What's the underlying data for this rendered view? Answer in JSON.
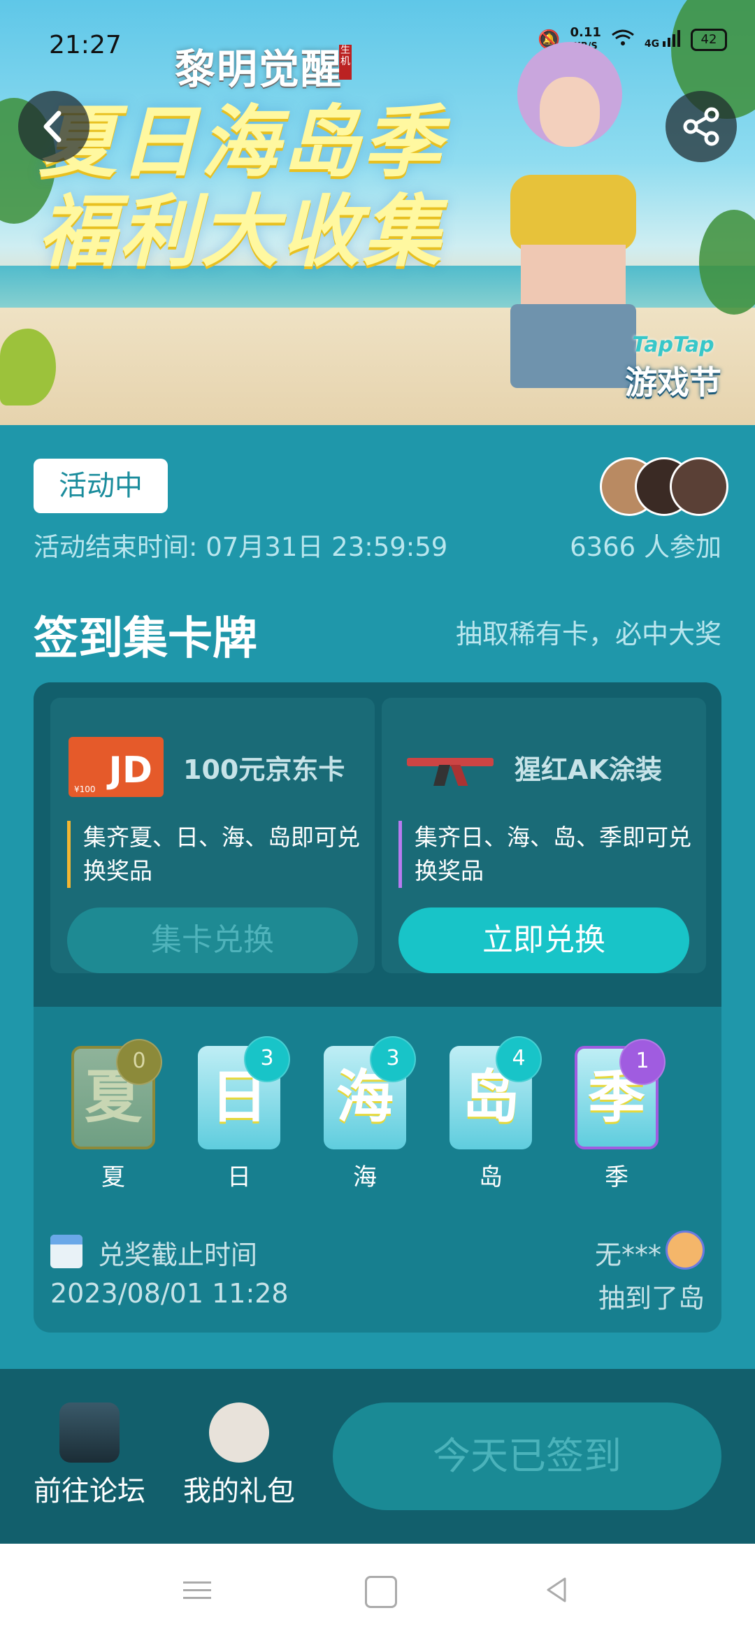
{
  "status_bar": {
    "time": "21:27",
    "net_speed_value": "0.11",
    "net_speed_unit": "KB/S",
    "network": "4G",
    "battery": "42"
  },
  "banner": {
    "game_logo": "黎明觉醒",
    "game_logo_sub": "生机",
    "title_line1": "夏日海岛季",
    "title_line2": "福利大收集",
    "festival_brand": "TapTap",
    "festival_name": "游戏节"
  },
  "event": {
    "status_badge": "活动中",
    "end_time": "活动结束时间: 07月31日 23:59:59",
    "participants": "6366 人参加"
  },
  "section": {
    "title": "签到集卡牌",
    "subtitle": "抽取稀有卡，必中大奖"
  },
  "rewards": [
    {
      "name": "100元京东卡",
      "image_text": "JD",
      "image_value": "¥100",
      "description": "集齐夏、日、海、岛即可兑换奖品",
      "button": "集卡兑换",
      "enabled": false
    },
    {
      "name": "猩红AK涂装",
      "description": "集齐日、海、岛、季即可兑换奖品",
      "button": "立即兑换",
      "enabled": true
    }
  ],
  "cards": [
    {
      "char": "夏",
      "count": "0",
      "label": "夏"
    },
    {
      "char": "日",
      "count": "3",
      "label": "日"
    },
    {
      "char": "海",
      "count": "3",
      "label": "海"
    },
    {
      "char": "岛",
      "count": "4",
      "label": "岛"
    },
    {
      "char": "季",
      "count": "1",
      "label": "季"
    }
  ],
  "deadline": {
    "label": "兑奖截止时间",
    "value": "2023/08/01 11:28"
  },
  "winner": {
    "name": "无***",
    "text": "抽到了岛"
  },
  "bottom": {
    "forum": "前往论坛",
    "gift": "我的礼包",
    "checkin": "今天已签到"
  },
  "icons": {
    "back": "chevron-left-icon",
    "share": "share-icon",
    "calendar": "calendar-icon"
  }
}
